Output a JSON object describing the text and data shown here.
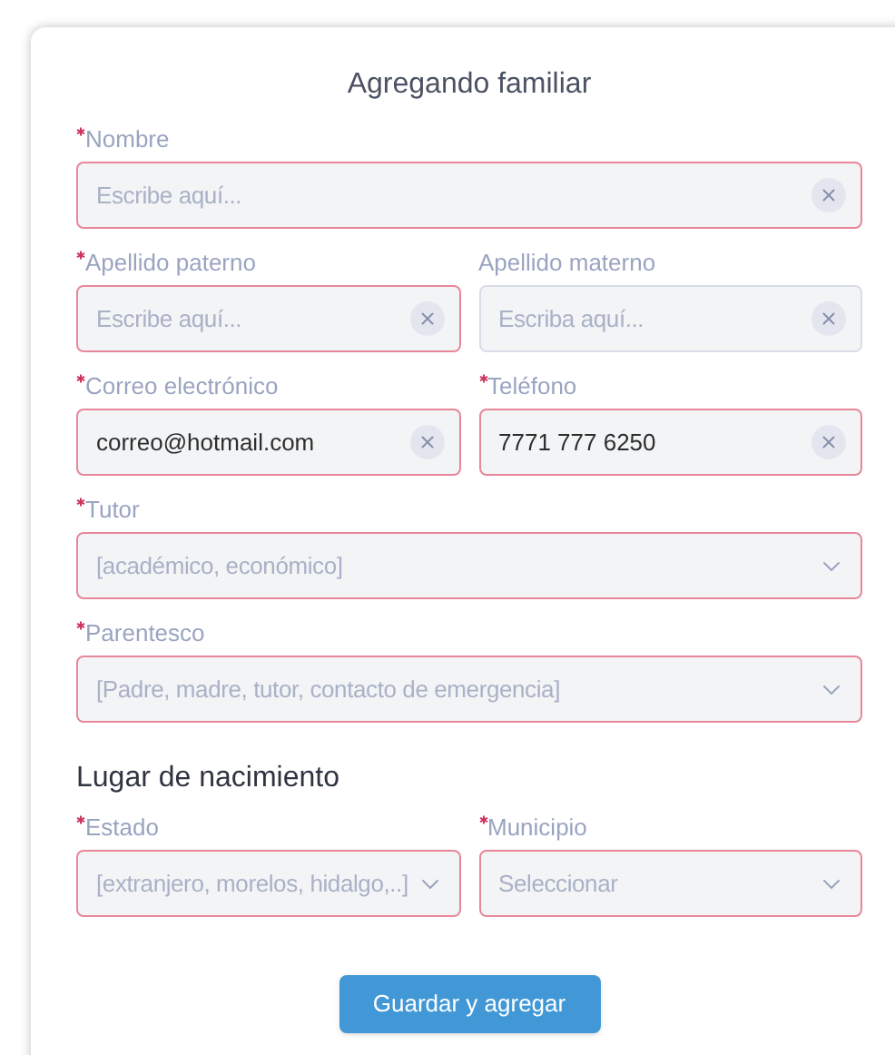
{
  "title": "Agregando familiar",
  "rows": [
    {
      "fields": [
        {
          "kind": "text",
          "label": "Nombre",
          "required": true,
          "placeholder": "Escribe aquí..."
        }
      ]
    },
    {
      "fields": [
        {
          "kind": "text",
          "label": "Apellido paterno",
          "required": true,
          "placeholder": "Escribe aquí..."
        },
        {
          "kind": "text",
          "label": "Apellido materno",
          "required": false,
          "placeholder": "Escriba aquí..."
        }
      ]
    },
    {
      "fields": [
        {
          "kind": "text",
          "label": "Correo electrónico",
          "required": true,
          "value": "correo@hotmail.com"
        },
        {
          "kind": "text",
          "label": "Teléfono",
          "required": true,
          "value": "7771 777 6250"
        }
      ]
    },
    {
      "fields": [
        {
          "kind": "select",
          "label": "Tutor",
          "required": true,
          "placeholder": "[académico, económico]"
        }
      ]
    },
    {
      "fields": [
        {
          "kind": "select",
          "label": "Parentesco",
          "required": true,
          "placeholder": "[Padre, madre, tutor, contacto de emergencia]"
        }
      ]
    }
  ],
  "section": {
    "heading": "Lugar de nacimiento",
    "rows": [
      {
        "fields": [
          {
            "kind": "select",
            "label": "Estado",
            "required": true,
            "placeholder": "[extranjero, morelos, hidalgo,..]"
          },
          {
            "kind": "select",
            "label": "Municipio",
            "required": true,
            "placeholder": "Seleccionar"
          }
        ]
      }
    ]
  },
  "button": "Guardar y agregar"
}
